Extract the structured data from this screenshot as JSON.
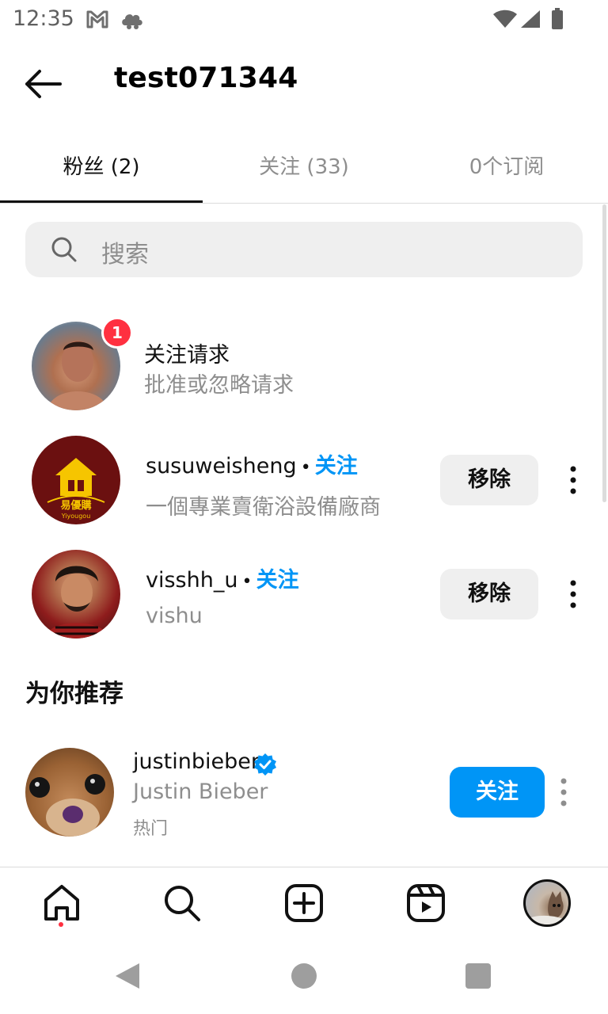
{
  "status_bar": {
    "time": "12:35"
  },
  "header": {
    "title": "test071344"
  },
  "tabs": [
    {
      "label": "粉丝 (2)",
      "active": true
    },
    {
      "label": "关注 (33)",
      "active": false
    },
    {
      "label": "0个订阅",
      "active": false
    }
  ],
  "search": {
    "placeholder": "搜索"
  },
  "follow_requests": {
    "title": "关注请求",
    "subtitle": "批准或忽略请求",
    "badge_count": "1"
  },
  "followers": [
    {
      "username": "susuweisheng",
      "separator": "•",
      "follow_label": "关注",
      "subtitle": "一個專業賣衛浴設備廠商",
      "remove_label": "移除",
      "avatar_text": "易優購",
      "avatar_subtext": "Yiyougou"
    },
    {
      "username": "visshh_u",
      "separator": "•",
      "follow_label": "关注",
      "subtitle": "vishu",
      "remove_label": "移除"
    }
  ],
  "suggested": {
    "title": "为你推荐",
    "items": [
      {
        "username": "justinbieber",
        "verified": true,
        "full_name": "Justin Bieber",
        "tag": "热门",
        "follow_label": "关注"
      }
    ]
  },
  "colors": {
    "accent": "#0095f6",
    "badge": "#ff3040",
    "muted_text": "#8e8e8e",
    "button_bg": "#efefef"
  }
}
